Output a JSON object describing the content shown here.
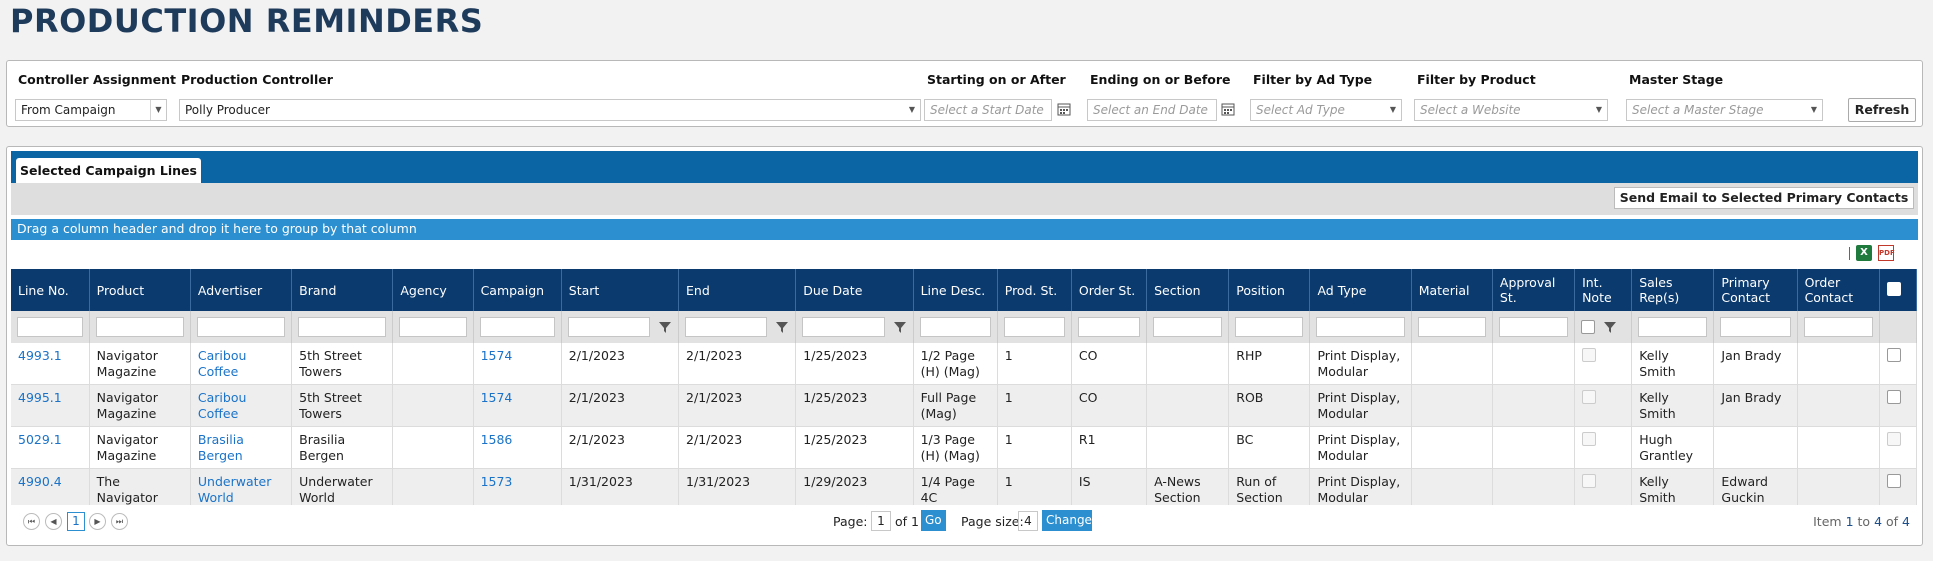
{
  "page": {
    "title": "PRODUCTION REMINDERS"
  },
  "filters": {
    "controller_assignment": {
      "label": "Controller Assignment",
      "value": "From Campaign"
    },
    "production_controller": {
      "label": "Production Controller",
      "value": "Polly Producer"
    },
    "start_date": {
      "label": "Starting on or After",
      "placeholder": "Select a Start Date"
    },
    "end_date": {
      "label": "Ending on or Before",
      "placeholder": "Select an End Date"
    },
    "ad_type": {
      "label": "Filter by Ad Type",
      "placeholder": "Select Ad Type"
    },
    "product": {
      "label": "Filter by Product",
      "placeholder": "Select a Website"
    },
    "master_stage": {
      "label": "Master Stage",
      "placeholder": "Select a Master Stage"
    },
    "refresh_label": "Refresh"
  },
  "grid": {
    "tab_label": "Selected Campaign Lines",
    "send_email_label": "Send Email to Selected Primary Contacts",
    "group_hint": "Drag a column header and drop it here to group by that column",
    "export_icons": [
      "excel-icon",
      "pdf-icon"
    ],
    "columns": [
      "Line No.",
      "Product",
      "Advertiser",
      "Brand",
      "Agency",
      "Campaign",
      "Start",
      "End",
      "Due Date",
      "Line Desc.",
      "Prod. St.",
      "Order St.",
      "Section",
      "Position",
      "Ad Type",
      "Material",
      "Approval St.",
      "Int. Note",
      "Sales Rep(s)",
      "Primary Contact",
      "Order Contact"
    ],
    "rows": [
      {
        "line_no": "4993.1",
        "product": "Navigator Magazine",
        "advertiser": "Caribou Coffee",
        "brand": "5th Street Towers",
        "agency": "",
        "campaign": "1574",
        "start": "2/1/2023",
        "end": "2/1/2023",
        "due": "1/25/2023",
        "desc": "1/2 Page (H) (Mag)",
        "prod_st": "1",
        "order_st": "CO",
        "section": "",
        "position": "RHP",
        "ad_type": "Print Display, Modular",
        "material": "",
        "approval": "",
        "sales_rep": "Kelly Smith",
        "primary_contact": "Jan Brady",
        "order_contact": ""
      },
      {
        "line_no": "4995.1",
        "product": "Navigator Magazine",
        "advertiser": "Caribou Coffee",
        "brand": "5th Street Towers",
        "agency": "",
        "campaign": "1574",
        "start": "2/1/2023",
        "end": "2/1/2023",
        "due": "1/25/2023",
        "desc": "Full Page (Mag)",
        "prod_st": "1",
        "order_st": "CO",
        "section": "",
        "position": "ROB",
        "ad_type": "Print Display, Modular",
        "material": "",
        "approval": "",
        "sales_rep": "Kelly Smith",
        "primary_contact": "Jan Brady",
        "order_contact": ""
      },
      {
        "line_no": "5029.1",
        "product": "Navigator Magazine",
        "advertiser": "Brasilia Bergen",
        "brand": "Brasilia Bergen",
        "agency": "",
        "campaign": "1586",
        "start": "2/1/2023",
        "end": "2/1/2023",
        "due": "1/25/2023",
        "desc": "1/3 Page (H) (Mag)",
        "prod_st": "1",
        "order_st": "R1",
        "section": "",
        "position": "BC",
        "ad_type": "Print Display, Modular",
        "material": "",
        "approval": "",
        "sales_rep": "Hugh Grantley",
        "primary_contact": "",
        "order_contact": ""
      },
      {
        "line_no": "4990.4",
        "product": "The Navigator Times",
        "advertiser": "Underwater World",
        "brand": "Underwater World",
        "agency": "",
        "campaign": "1573",
        "start": "1/31/2023",
        "end": "1/31/2023",
        "due": "1/29/2023",
        "desc": "1/4 Page 4C",
        "prod_st": "1",
        "order_st": "IS",
        "section": "A-News Section",
        "position": "Run of Section",
        "ad_type": "Print Display, Modular",
        "material": "",
        "approval": "",
        "sales_rep": "Kelly Smith",
        "primary_contact": "Edward Guckin",
        "order_contact": ""
      }
    ]
  },
  "pager": {
    "current_page": "1",
    "page_label": "Page:",
    "page_value": "1",
    "of_text": "of 1",
    "go_label": "Go",
    "page_size_label": "Page size:",
    "page_size_value": "4",
    "change_label": "Change",
    "item_word": "Item",
    "item_from": "1",
    "to_word": "to",
    "item_to": "4",
    "of_word": "of",
    "item_total": "4"
  }
}
